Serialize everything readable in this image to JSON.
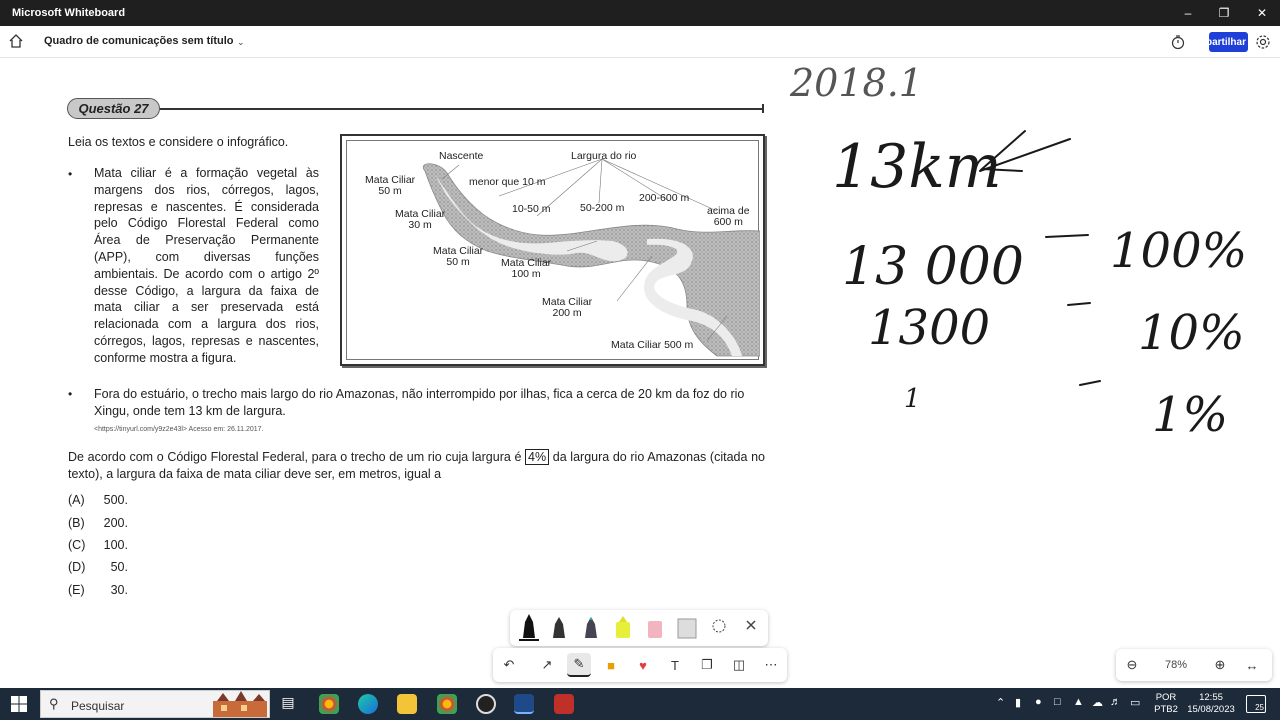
{
  "window": {
    "title": "Microsoft Whiteboard"
  },
  "appbar": {
    "board_title": "Quadro de comunicações sem título",
    "share_label": "Compartilhar"
  },
  "question": {
    "badge": "Questão 27",
    "intro": "Leia os textos e considere o infográfico.",
    "bullet1": "Mata ciliar é a formação vegetal às margens dos rios, córregos, lagos, represas e nascentes. É considerada pelo Código Florestal Federal como Área de Preservação Permanente (APP), com diversas funções ambientais. De acordo com o artigo 2º desse Código, a largura da faixa de mata ciliar a ser preservada está relacionada com a largura dos rios, córregos, lagos, represas e nascentes, conforme mostra a figura.",
    "bullet2": "Fora do estuário, o trecho mais largo do rio Amazonas, não interrompido por ilhas, fica a cerca de 20 km da foz do rio Xingu, onde tem 13 km de largura.",
    "source": "<https://tinyurl.com/y9z2e43l> Acesso em: 26.11.2017.",
    "prompt_a": "De acordo com o Código Florestal Federal, para o trecho de um rio cuja largura é ",
    "prompt_pct": "4%",
    "prompt_b": " da largura do rio Amazonas (citada no texto), a largura da faixa de mata ciliar deve ser, em metros, igual a",
    "options": [
      {
        "letter": "(A)",
        "value": "500."
      },
      {
        "letter": "(B)",
        "value": "200."
      },
      {
        "letter": "(C)",
        "value": "100."
      },
      {
        "letter": "(D)",
        "value": "50."
      },
      {
        "letter": "(E)",
        "value": "30."
      }
    ]
  },
  "infographic": {
    "nascente": "Nascente",
    "largura": "Largura do rio",
    "mc50a": "Mata Ciliar\n50 m",
    "menor10": "menor que 10 m",
    "mc30": "Mata Ciliar\n30 m",
    "r10_50": "10-50 m",
    "r50_200": "50-200 m",
    "r200_600": "200-600 m",
    "acima600": "acima de\n600 m",
    "mc50b": "Mata Ciliar\n50 m",
    "mc100": "Mata Ciliar\n100 m",
    "mc200": "Mata Ciliar\n200 m",
    "mc500": "Mata Ciliar 500 m"
  },
  "ink": {
    "year": "2018.1",
    "km": "13km",
    "n1": "13 000",
    "p1": "100%",
    "n2": "1300",
    "p2": "10%",
    "n3": "1",
    "p3": "1%"
  },
  "zoom": {
    "value": "78%"
  },
  "taskbar": {
    "search_placeholder": "Pesquisar",
    "lang": "POR\nPTB2",
    "time": "12:55",
    "date": "15/08/2023",
    "notif": "25"
  },
  "colors": {
    "share": "#1e3fd8",
    "taskbar": "#1c2a3a",
    "titlebar": "#1f1f1f"
  }
}
